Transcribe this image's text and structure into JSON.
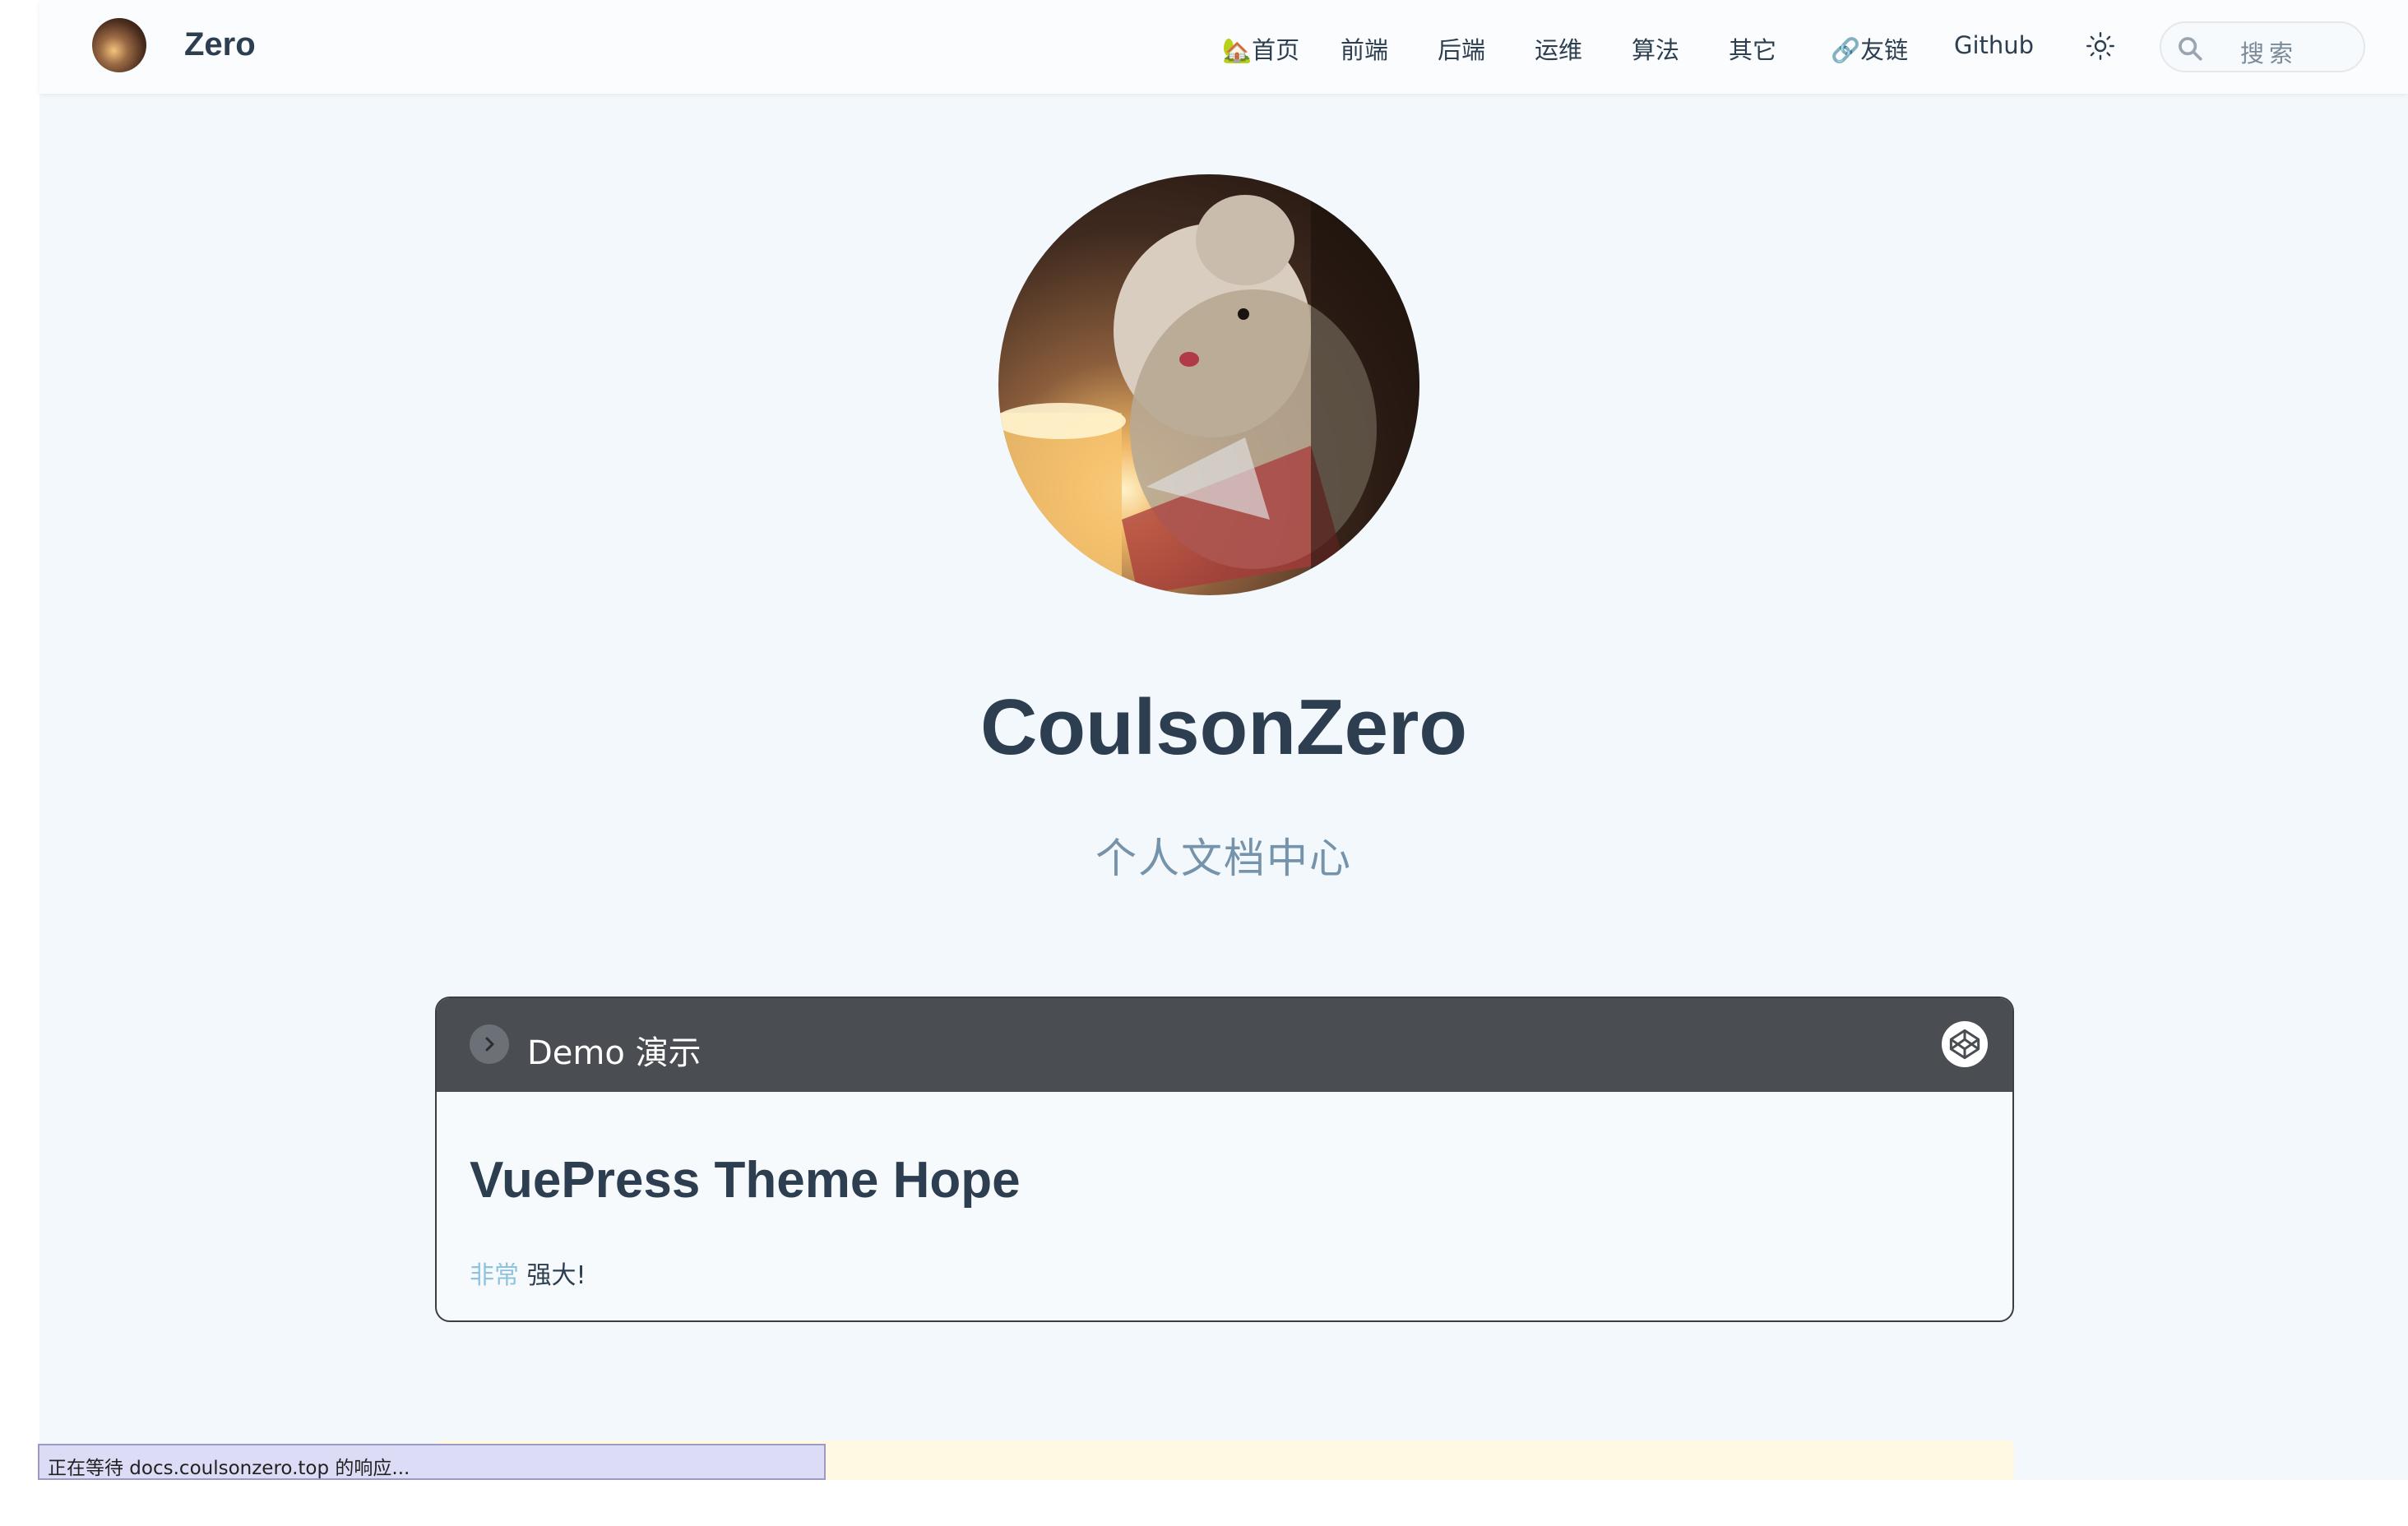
{
  "navbar": {
    "brand_name": "Zero",
    "items": [
      {
        "label": "🏡首页"
      },
      {
        "label": "前端"
      },
      {
        "label": "后端"
      },
      {
        "label": "运维"
      },
      {
        "label": "算法"
      },
      {
        "label": "其它"
      },
      {
        "label": "🔗友链"
      },
      {
        "label": "Github"
      }
    ],
    "search_placeholder": "搜索"
  },
  "hero": {
    "title": "CoulsonZero",
    "tagline": "个人文档中心"
  },
  "demo": {
    "header_title": "Demo 演示",
    "heading": "VuePress Theme Hope",
    "text_accent": "非常",
    "text_rest": " 强大!"
  },
  "status_bar": {
    "text": "正在等待 docs.coulsonzero.top 的响应..."
  },
  "colors": {
    "page_bg": "#f3f8fc",
    "demo_header": "#4a4d52",
    "accent": "#8fc3dd",
    "tagline": "#7593aa"
  }
}
